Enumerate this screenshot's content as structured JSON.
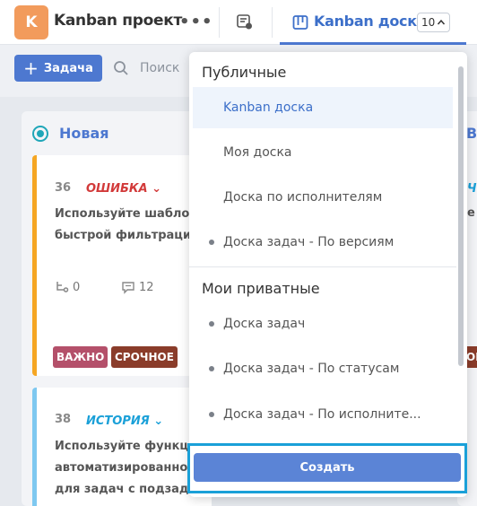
{
  "header": {
    "avatar_letter": "K",
    "project_title": "Kanban проект",
    "menu_icon": "more-dots-icon",
    "boards_icon": "boards-settings-icon",
    "active_tab": {
      "label": "Kanban доска",
      "count": "10",
      "icon": "kanban-icon"
    }
  },
  "toolbar": {
    "add_task_label": "Задача",
    "search_placeholder": "Поиск"
  },
  "board": {
    "columns": [
      {
        "title": "Новая"
      },
      {
        "title": "В"
      }
    ],
    "cards": [
      {
        "number": "36",
        "type": "ОШИБКА",
        "type_color": "#d23a3a",
        "border_color": "#f5a623",
        "text_lines": [
          "Используйте шаблоны",
          "быстрой фильтрации"
        ],
        "subtasks": "0",
        "comments": "12",
        "tags": [
          {
            "label": "ВАЖНО",
            "color": "#b4506a"
          },
          {
            "label": "СРОЧНОЕ",
            "color": "#8a3c2a"
          }
        ]
      },
      {
        "number": "38",
        "type": "ИСТОРИЯ",
        "type_color": "#1aa0d8",
        "border_color": "#7ec8f0",
        "text_lines": [
          "Используйте функции",
          "автоматизированного",
          "для задач с подзадачами"
        ]
      }
    ],
    "peek_labels": {
      "type_fragment": "Ч",
      "text_fragment": "е",
      "tag_fragment": "ОР"
    }
  },
  "dropdown": {
    "public_header": "Публичные",
    "public_items": [
      {
        "label": "Kanban доска",
        "active": true,
        "dot": false
      },
      {
        "label": "Моя доска",
        "active": false,
        "dot": false
      },
      {
        "label": "Доска по исполнителям",
        "active": false,
        "dot": false
      },
      {
        "label": "Доска задач - По версиям",
        "active": false,
        "dot": true
      }
    ],
    "private_header": "Мои приватные",
    "private_items": [
      {
        "label": "Доска задач",
        "dot": true
      },
      {
        "label": "Доска задач - По статусам",
        "dot": true
      },
      {
        "label": "Доска задач - По исполните...",
        "dot": true
      }
    ],
    "create_label": "Создать"
  }
}
